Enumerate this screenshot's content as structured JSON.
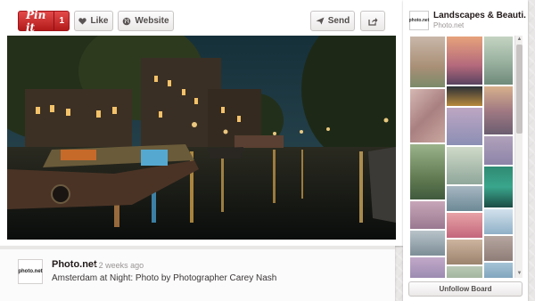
{
  "toolbar": {
    "pinit_label": "Pin it",
    "pinit_count": "1",
    "like_label": "Like",
    "website_label": "Website",
    "send_label": "Send",
    "icons": [
      "heart-icon",
      "globe-icon",
      "send-icon",
      "share-icon"
    ]
  },
  "pin": {
    "source_name": "Photo.net",
    "time_ago": "• 2 weeks ago",
    "description": "Amsterdam at Night: Photo by Photographer Carey Nash",
    "avatar_text": "photo.net"
  },
  "board": {
    "title": "Landscapes & Beauti...",
    "owner": "Photo.net",
    "avatar_text": "photo.net",
    "unfollow_label": "Unfollow Board"
  },
  "colors": {
    "pinit_red": "#c8232c",
    "background": "#e9e6e6",
    "card": "#ffffff"
  }
}
